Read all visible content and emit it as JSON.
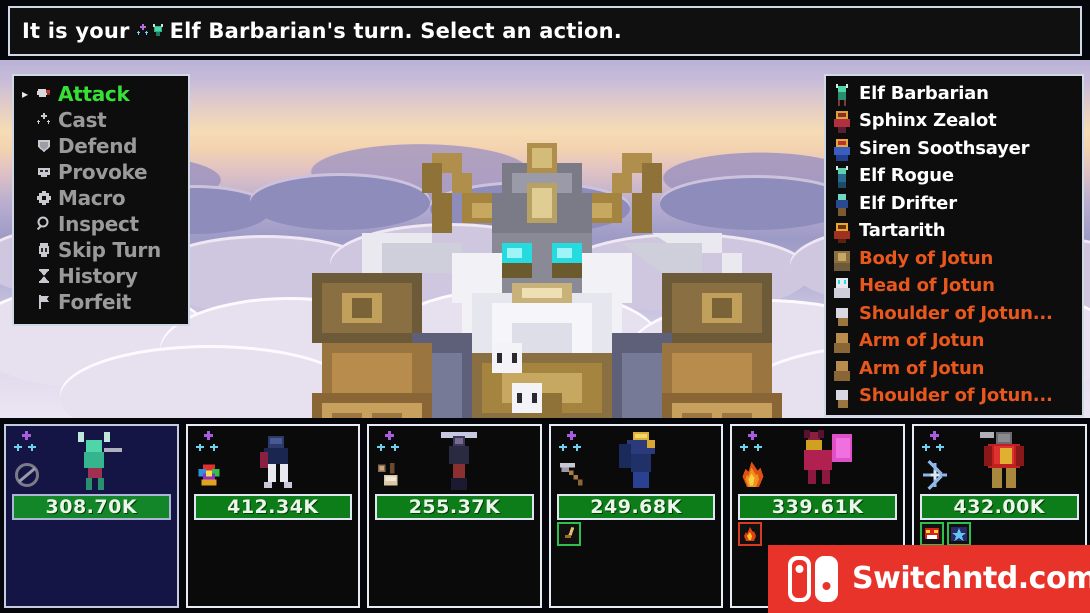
{
  "header": {
    "message_prefix": "It is your ",
    "unit_name": "Elf Barbarian",
    "message_suffix": "'s turn. Select an action.",
    "full_text": "It is your Elf Barbarian's turn. Select an action."
  },
  "colors": {
    "selected_action": "#36e036",
    "unselected_action": "#9a9a9a",
    "ally_name": "#ffffff",
    "enemy_name": "#e8571c",
    "hp_bar_fill": "#0d7d19",
    "panel_border": "#cfd8e6",
    "panel_bg": "#0d0d0d",
    "active_card_bg": "#151545",
    "watermark_bg": "#e8332a"
  },
  "action_menu": {
    "cursor": "▸",
    "items": [
      {
        "label": "Attack",
        "icon": "sword-icon",
        "selected": true
      },
      {
        "label": "Cast",
        "icon": "sparkle-icon",
        "selected": false
      },
      {
        "label": "Defend",
        "icon": "shield-icon",
        "selected": false
      },
      {
        "label": "Provoke",
        "icon": "taunt-icon",
        "selected": false
      },
      {
        "label": "Macro",
        "icon": "gear-icon",
        "selected": false
      },
      {
        "label": "Inspect",
        "icon": "magnifier-icon",
        "selected": false
      },
      {
        "label": "Skip Turn",
        "icon": "skip-icon",
        "selected": false
      },
      {
        "label": "History",
        "icon": "hourglass-icon",
        "selected": false
      },
      {
        "label": "Forfeit",
        "icon": "flag-icon",
        "selected": false
      }
    ]
  },
  "turn_order": {
    "items": [
      {
        "name": "Elf Barbarian",
        "side": "ally",
        "portrait": "elf-barbarian-portrait"
      },
      {
        "name": "Sphinx Zealot",
        "side": "ally",
        "portrait": "sphinx-zealot-portrait"
      },
      {
        "name": "Siren Soothsayer",
        "side": "ally",
        "portrait": "siren-soothsayer-portrait"
      },
      {
        "name": "Elf Rogue",
        "side": "ally",
        "portrait": "elf-rogue-portrait"
      },
      {
        "name": "Elf Drifter",
        "side": "ally",
        "portrait": "elf-drifter-portrait"
      },
      {
        "name": "Tartarith",
        "side": "ally",
        "portrait": "tartarith-portrait"
      },
      {
        "name": "Body of Jotun",
        "side": "foe",
        "portrait": "body-of-jotun-portrait"
      },
      {
        "name": "Head of Jotun",
        "side": "foe",
        "portrait": "head-of-jotun-portrait"
      },
      {
        "name": "Shoulder of Jotun...",
        "side": "foe",
        "portrait": "shoulder-of-jotun-portrait"
      },
      {
        "name": "Arm of Jotun",
        "side": "foe",
        "portrait": "arm-of-jotun-portrait"
      },
      {
        "name": "Arm of Jotun",
        "side": "foe",
        "portrait": "arm-of-jotun-portrait"
      },
      {
        "name": "Shoulder of Jotun...",
        "side": "foe",
        "portrait": "shoulder-of-jotun-portrait"
      }
    ]
  },
  "party": {
    "cards": [
      {
        "hp": "308.70K",
        "active": true,
        "ap_points": 3,
        "secondary_icon": "no-repeat-icon",
        "sprite": "elf-barbarian-sprite",
        "buffs": []
      },
      {
        "hp": "412.34K",
        "active": false,
        "ap_points": 3,
        "secondary_icon": "rainbow-gem-icon",
        "sprite": "sphinx-zealot-sprite",
        "buffs": []
      },
      {
        "hp": "255.37K",
        "active": false,
        "ap_points": 3,
        "secondary_icon": "potion-mug-icon",
        "sprite": "siren-soothsayer-sprite",
        "buffs": []
      },
      {
        "hp": "249.68K",
        "active": false,
        "ap_points": 3,
        "secondary_icon": "pickaxe-icon",
        "sprite": "elf-rogue-sprite",
        "buffs": [
          {
            "icon": "sword-buff-icon",
            "kind": "good"
          }
        ]
      },
      {
        "hp": "339.61K",
        "active": false,
        "ap_points": 3,
        "secondary_icon": "flame-icon",
        "sprite": "elf-drifter-sprite",
        "buffs": [
          {
            "icon": "burn-debuff-icon",
            "kind": "bad"
          }
        ]
      },
      {
        "hp": "432.00K",
        "active": false,
        "ap_points": 3,
        "secondary_icon": "frost-icon",
        "sprite": "tartarith-sprite",
        "buffs": [
          {
            "icon": "rage-buff-icon",
            "kind": "good"
          },
          {
            "icon": "star-buff-icon",
            "kind": "good"
          }
        ]
      }
    ]
  },
  "battlefield": {
    "boss_name": "Jotun",
    "background": "sunset-clouds-background"
  },
  "watermark": {
    "text": "Switchntd.com",
    "logo": "nintendo-switch-logo"
  }
}
